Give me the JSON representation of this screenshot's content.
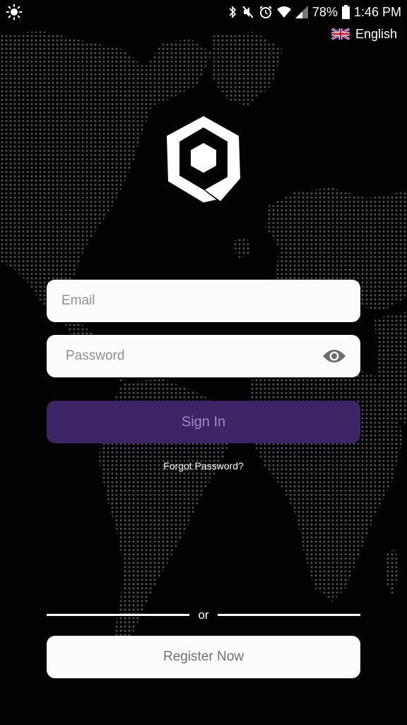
{
  "status_bar": {
    "battery": "78%",
    "time": "1:46 PM",
    "icons": [
      "brightness-icon",
      "bluetooth-icon",
      "mute-icon",
      "alarm-icon",
      "wifi-icon",
      "signal-icon",
      "battery-icon"
    ]
  },
  "language": {
    "label": "English",
    "flag": "uk-flag-icon"
  },
  "login": {
    "email_placeholder": "Email",
    "password_placeholder": "Password",
    "sign_in_label": "Sign In",
    "forgot_label": "Forgot Password?"
  },
  "divider": {
    "label": "or"
  },
  "register": {
    "label": "Register Now"
  },
  "colors": {
    "background": "#020202",
    "sign_in_button": "#3b2567",
    "sign_in_text": "#9a8fb6",
    "field_background": "#fcfbfd",
    "map_dots": "#5c5460"
  }
}
